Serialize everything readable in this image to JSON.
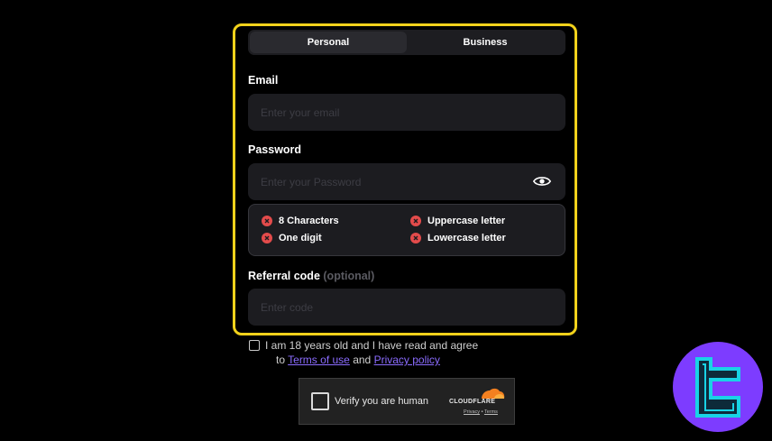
{
  "tabs": [
    {
      "label": "Personal",
      "active": true
    },
    {
      "label": "Business",
      "active": false
    }
  ],
  "email": {
    "label": "Email",
    "placeholder": "Enter your email"
  },
  "password": {
    "label": "Password",
    "placeholder": "Enter your Password"
  },
  "password_rules": [
    {
      "label": "8 Characters",
      "met": false
    },
    {
      "label": "Uppercase letter",
      "met": false
    },
    {
      "label": "One digit",
      "met": false
    },
    {
      "label": "Lowercase letter",
      "met": false
    }
  ],
  "referral": {
    "label": "Referral code",
    "optional": "(optional)",
    "placeholder": "Enter code"
  },
  "agreement": {
    "line1": "I am 18 years old and I have read and agree",
    "line2_prefix": "to",
    "terms_link": "Terms of use",
    "and_text": "and",
    "privacy_link": "Privacy policy",
    "checked": false
  },
  "captcha": {
    "label": "Verify you are human",
    "brand": "CLOUDFLARE",
    "privacy": "Privacy",
    "separator": "•",
    "terms": "Terms"
  },
  "colors": {
    "highlight": "#f2d21b",
    "link": "#8b6cff",
    "error": "#e34b4b",
    "badge": "#7d3cff",
    "badge_icon": "#19d3e6",
    "cloudflare_orange": "#f38020"
  },
  "icons": [
    "eye-icon",
    "x-circle-icon",
    "cloudflare-logo-icon",
    "brand-logo-icon"
  ]
}
